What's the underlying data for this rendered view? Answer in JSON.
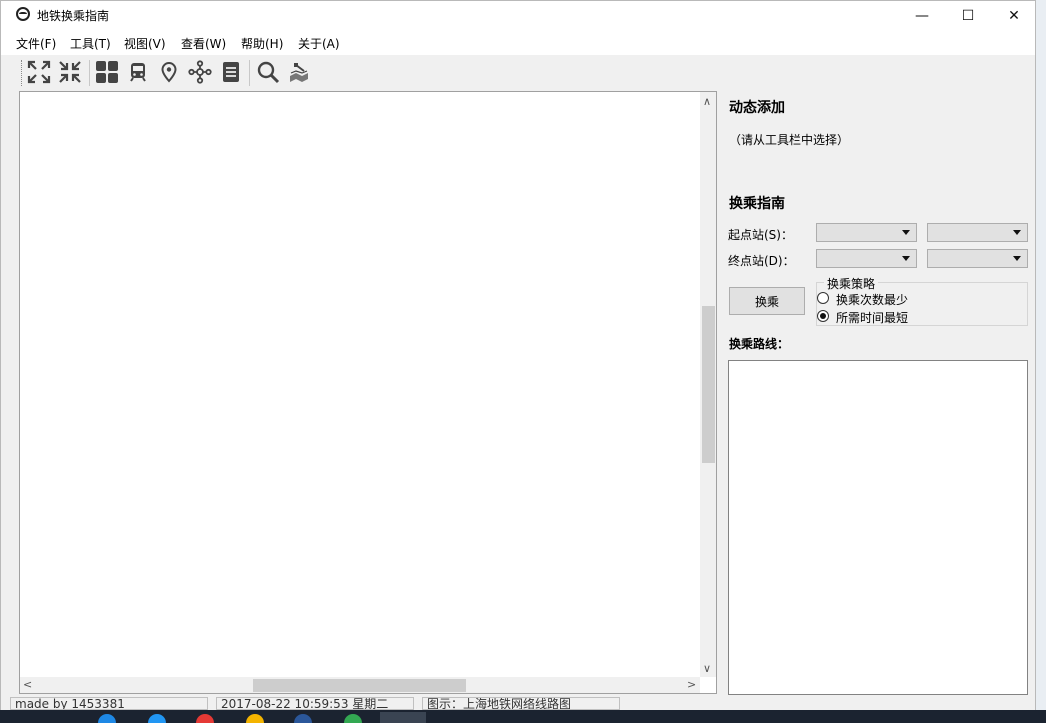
{
  "window": {
    "title": "地铁换乘指南",
    "controls": {
      "minimize": "—",
      "maximize": "☐",
      "close": "✕"
    }
  },
  "menu": [
    {
      "label": "文件(F)"
    },
    {
      "label": "工具(T)"
    },
    {
      "label": "视图(V)"
    },
    {
      "label": "查看(W)"
    },
    {
      "label": "帮助(H)"
    },
    {
      "label": "关于(A)"
    }
  ],
  "toolbar": {
    "icons": [
      "expand-icon",
      "collapse-icon",
      "grid-icon",
      "train-icon",
      "location-pin-icon",
      "network-nodes-icon",
      "list-icon",
      "search-icon",
      "map-icon"
    ]
  },
  "panel": {
    "dynamic_add_title": "动态添加",
    "dynamic_add_hint": "（请从工具栏中选择）",
    "transfer_guide_title": "换乘指南",
    "start_label": "起点站(S)：",
    "end_label": "终点站(D)：",
    "transfer_button": "换乘",
    "strategy_group": "换乘策略",
    "strategy_options": [
      {
        "label": "换乘次数最少",
        "checked": false
      },
      {
        "label": "所需时间最短",
        "checked": true
      }
    ],
    "route_title": "换乘路线："
  },
  "status": {
    "author": "made by 1453381",
    "datetime": "2017-08-22 10:59:53 星期二",
    "legend": "图示：上海地铁网络线路图"
  },
  "colors": {
    "window_bg": "#f0f0f0",
    "canvas_bg": "#ffffff",
    "taskbar": "#1b2330"
  }
}
